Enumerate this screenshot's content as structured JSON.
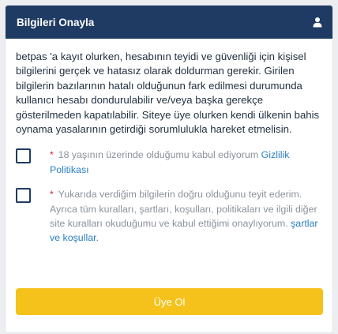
{
  "header": {
    "title": "Bilgileri Onayla",
    "icon": "user-icon"
  },
  "intro_text": "betpas 'a kayıt olurken, hesabının teyidi ve güvenliği için kişisel bilgilerini gerçek ve hatasız olarak doldurman gerekir. Girilen bilgilerin bazılarının hatalı olduğunun fark edilmesi durumunda kullanıcı hesabı dondurulabilir ve/veya başka gerekçe gösterilmeden kapatılabilir. Siteye üye olurken kendi ülkenin bahis oynama yasalarının getirdiği sorumlulukla hareket etmelisin.",
  "checkboxes": [
    {
      "asterisk": "*",
      "text": "18 yaşının üzerinde olduğumu kabul ediyorum",
      "link": "Gizlilik Politikası",
      "trailing": "",
      "checked": false
    },
    {
      "asterisk": "*",
      "text": "Yukarıda verdiğim bilgilerin doğru olduğunu teyit ederim. Ayrıca tüm kuralları, şartları, koşulları, politikaları ve ilgili diğer site kuralları okuduğumu ve kabul ettiğimi onaylıyorum.",
      "link": "şartlar ve koşullar",
      "trailing": ".",
      "checked": false
    }
  ],
  "submit_label": "Üye Ol",
  "colors": {
    "header_bg": "#1f3b63",
    "button_bg": "#f5c21b",
    "link": "#2a7fc4",
    "asterisk": "#d0202e"
  }
}
